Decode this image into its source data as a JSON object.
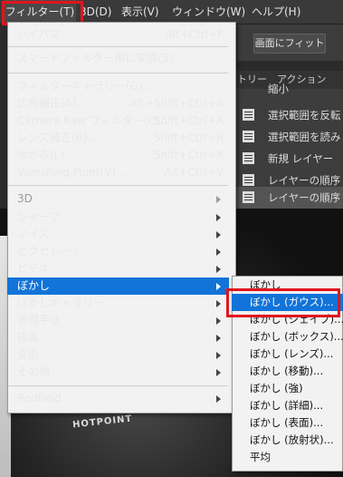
{
  "menubar": {
    "items": [
      "フィルター(T)",
      "3D(D)",
      "表示(V)",
      "ウィンドウ(W)",
      "ヘルプ(H)"
    ]
  },
  "options_bar": {
    "fit_screen_label": "画面にフィット"
  },
  "panels": {
    "tabs": [
      "トリー",
      "アクション"
    ],
    "history_items": [
      "縮小",
      "選択範囲を反転",
      "選択範囲を読み",
      "新規 レイヤー",
      "レイヤーの順序",
      "レイヤーの順序"
    ]
  },
  "canvas": {
    "jersey_text": "HOTPOINT"
  },
  "filter_menu": {
    "items": [
      {
        "label": "ハイパス",
        "shortcut": "Alt+Ctrl+F"
      },
      {
        "label": "スマートフィルター用に変換(S)",
        "shortcut": ""
      },
      {
        "label": "フィルターギャラリー(G)...",
        "shortcut": ""
      },
      {
        "label": "広角補正(A)...",
        "shortcut": "Alt+Shift+Ctrl+A"
      },
      {
        "label": "Camera Raw フィルター(C)...",
        "shortcut": "Shift+Ctrl+A"
      },
      {
        "label": "レンズ補正(R)...",
        "shortcut": "Shift+Ctrl+R"
      },
      {
        "label": "ゆがみ(L)...",
        "shortcut": "Shift+Ctrl+X"
      },
      {
        "label": "Vanishing Point(V)...",
        "shortcut": "Alt+Ctrl+V"
      },
      {
        "label": "3D",
        "shortcut": ""
      },
      {
        "label": "シャープ",
        "shortcut": ""
      },
      {
        "label": "ノイズ",
        "shortcut": ""
      },
      {
        "label": "ピクセレート",
        "shortcut": ""
      },
      {
        "label": "ビデオ",
        "shortcut": ""
      },
      {
        "label": "ぼかし",
        "shortcut": ""
      },
      {
        "label": "ぼかしギャラリー",
        "shortcut": ""
      },
      {
        "label": "表現手法",
        "shortcut": ""
      },
      {
        "label": "描画",
        "shortcut": ""
      },
      {
        "label": "変形",
        "shortcut": ""
      },
      {
        "label": "その他",
        "shortcut": ""
      },
      {
        "label": "Redfield",
        "shortcut": ""
      }
    ]
  },
  "blur_submenu": {
    "items": [
      "ぼかし",
      "ぼかし (ガウス)...",
      "ぼかし (シェイプ)...",
      "ぼかし (ボックス)...",
      "ぼかし (レンズ)...",
      "ぼかし (移動)...",
      "ぼかし (強)",
      "ぼかし (詳細)...",
      "ぼかし (表面)...",
      "ぼかし (放射状)...",
      "平均"
    ]
  },
  "colors": {
    "highlight": "#1273d8",
    "callout": "#e0161d",
    "menu_bg": "#f2f2f2",
    "dark_ui": "#3a3a3a"
  }
}
